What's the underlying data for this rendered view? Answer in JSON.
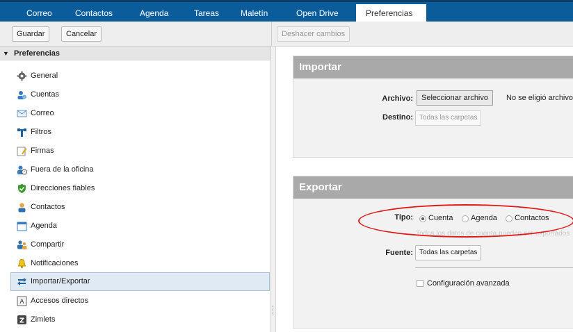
{
  "tabs": [
    {
      "label": "Correo",
      "active": false
    },
    {
      "label": "Contactos",
      "active": false
    },
    {
      "label": "Agenda",
      "active": false
    },
    {
      "label": "Tareas",
      "active": false
    },
    {
      "label": "Maletín",
      "active": false
    },
    {
      "label": "Open Drive",
      "active": false
    },
    {
      "label": "Preferencias",
      "active": true
    }
  ],
  "toolbar": {
    "save_label": "Guardar",
    "cancel_label": "Cancelar",
    "undo_label": "Deshacer cambios"
  },
  "sidebar": {
    "header": "Preferencias",
    "items": [
      {
        "label": "General",
        "icon": "gear-icon"
      },
      {
        "label": "Cuentas",
        "icon": "accounts-icon"
      },
      {
        "label": "Correo",
        "icon": "envelope-icon"
      },
      {
        "label": "Filtros",
        "icon": "filter-icon"
      },
      {
        "label": "Firmas",
        "icon": "signature-icon"
      },
      {
        "label": "Fuera de la oficina",
        "icon": "out-of-office-icon"
      },
      {
        "label": "Direcciones fiables",
        "icon": "trusted-shield-icon"
      },
      {
        "label": "Contactos",
        "icon": "contact-icon"
      },
      {
        "label": "Agenda",
        "icon": "calendar-icon"
      },
      {
        "label": "Compartir",
        "icon": "share-icon"
      },
      {
        "label": "Notificaciones",
        "icon": "bell-icon"
      },
      {
        "label": "Importar/Exportar",
        "icon": "import-export-icon",
        "selected": true
      },
      {
        "label": "Accesos directos",
        "icon": "keyboard-shortcut-icon"
      },
      {
        "label": "Zimlets",
        "icon": "zimlet-icon"
      }
    ]
  },
  "import": {
    "title": "Importar",
    "file_label": "Archivo:",
    "file_button": "Seleccionar archivo",
    "file_status": "No se eligió archivo",
    "dest_label": "Destino:",
    "dest_button": "Todas las carpetas"
  },
  "export": {
    "title": "Exportar",
    "type_label": "Tipo:",
    "options": [
      "Cuenta",
      "Agenda",
      "Contactos"
    ],
    "selected_option": "Cuenta",
    "hint": "Todos los datos de cuenta pueden ser exportados",
    "source_label": "Fuente:",
    "source_button": "Todas las carpetas",
    "advanced_label": "Configuración avanzada"
  },
  "colors": {
    "tabbar": "#0a5d9a",
    "panel_header": "#a9a9a9",
    "highlight_ellipse": "#e11b1b"
  }
}
